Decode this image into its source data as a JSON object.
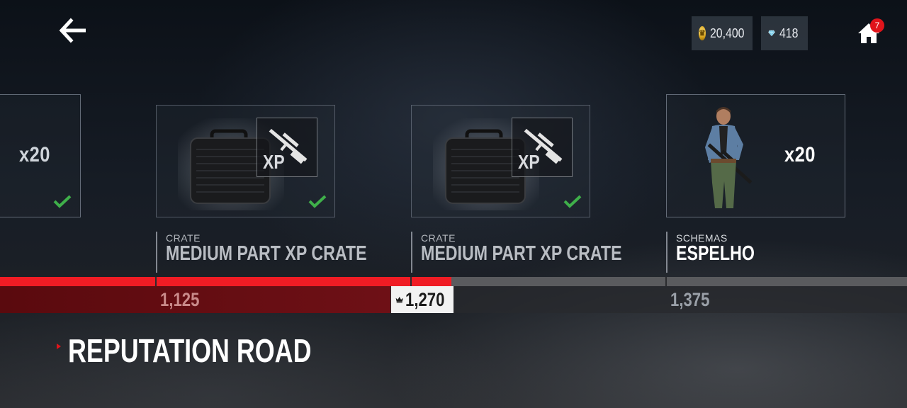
{
  "header": {
    "back_icon": "arrow-left-icon",
    "coins": {
      "icon": "crown-coin-icon",
      "value": "20,400"
    },
    "gems": {
      "icon": "diamond-icon",
      "value": "418"
    },
    "home": {
      "icon": "home-icon",
      "badge": "7"
    }
  },
  "rewards": [
    {
      "type": "",
      "name": "",
      "quantity": "x20",
      "claimed": true,
      "icon": "check-icon"
    },
    {
      "type": "CRATE",
      "name": "MEDIUM PART XP CRATE",
      "xp_label": "XP",
      "image": "briefcase-crate-icon",
      "overlay_icon": "sniper-rifle-icon",
      "claimed": true,
      "icon": "check-icon"
    },
    {
      "type": "CRATE",
      "name": "MEDIUM PART XP CRATE",
      "xp_label": "XP",
      "image": "briefcase-crate-icon",
      "overlay_icon": "sniper-rifle-icon",
      "claimed": true,
      "icon": "check-icon"
    },
    {
      "type": "SCHEMAS",
      "name": "ESPELHO",
      "quantity": "x20",
      "image": "character-portrait",
      "claimed": false
    }
  ],
  "progress": {
    "milestones": [
      "1,125",
      "1,270",
      "1,375"
    ],
    "current_value": "1,270",
    "current_icon": "crown-icon",
    "fill_fraction": 0.498
  },
  "title": "REPUTATION ROAD",
  "colors": {
    "accent_red": "#f01c24",
    "dark_red": "#5a0a0e",
    "claimed_green": "#3fb04a",
    "badge_red": "#e0141b"
  }
}
